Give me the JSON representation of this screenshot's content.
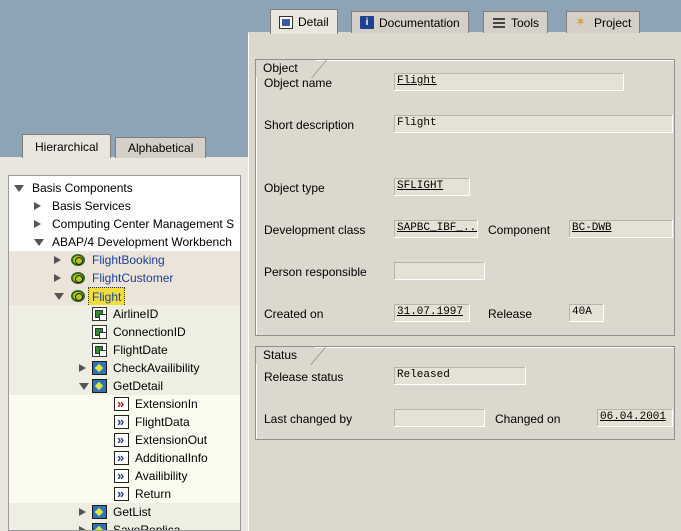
{
  "colors": {
    "background_blue": "#8fa3b6",
    "panel": "#dcd8ce",
    "link_blue": "#1a3f9a",
    "selection": "#f1dd3a"
  },
  "right_tabs": [
    {
      "label": "Detail",
      "icon": "detail-icon",
      "active": true
    },
    {
      "label": "Documentation",
      "icon": "info-icon",
      "active": false
    },
    {
      "label": "Tools",
      "icon": "tools-icon",
      "active": false
    },
    {
      "label": "Project",
      "icon": "wand-icon",
      "active": false
    }
  ],
  "object_group": {
    "title": "Object",
    "object_name": {
      "label": "Object name",
      "value": "Flight"
    },
    "short_description": {
      "label": "Short description",
      "value": "Flight"
    },
    "object_type": {
      "label": "Object type",
      "value": "SFLIGHT"
    },
    "development_class": {
      "label": "Development class",
      "value": "SAPBC_IBF_..."
    },
    "component": {
      "label": "Component",
      "value": "BC-DWB"
    },
    "person_responsible": {
      "label": "Person responsible",
      "value": ""
    },
    "created_on": {
      "label": "Created on",
      "value": "31.07.1997"
    },
    "release": {
      "label": "Release",
      "value": "40A"
    }
  },
  "status_group": {
    "title": "Status",
    "release_status": {
      "label": "Release status",
      "value": "Released"
    },
    "last_changed_by": {
      "label": "Last changed by",
      "value": ""
    },
    "changed_on": {
      "label": "Changed on",
      "value": "06.04.2001"
    }
  },
  "left_tabs": [
    {
      "label": "Hierarchical",
      "active": true
    },
    {
      "label": "Alphabetical",
      "active": false
    }
  ],
  "tree": [
    {
      "label": "Basis Components",
      "level": 0,
      "state": "expanded",
      "icon": ""
    },
    {
      "label": "Basis Services",
      "level": 1,
      "state": "collapsed",
      "icon": ""
    },
    {
      "label": "Computing Center Management S",
      "level": 1,
      "state": "collapsed",
      "icon": ""
    },
    {
      "label": "ABAP/4 Development Workbench",
      "level": 1,
      "state": "expanded",
      "icon": ""
    },
    {
      "label": "FlightBooking",
      "level": 2,
      "state": "collapsed",
      "icon": "object-icon"
    },
    {
      "label": "FlightCustomer",
      "level": 2,
      "state": "collapsed",
      "icon": "object-icon"
    },
    {
      "label": "Flight",
      "level": 2,
      "state": "expanded",
      "icon": "object-icon",
      "selected": true
    },
    {
      "label": "AirlineID",
      "level": 3,
      "state": "leaf",
      "icon": "attribute-icon"
    },
    {
      "label": "ConnectionID",
      "level": 3,
      "state": "leaf",
      "icon": "attribute-icon"
    },
    {
      "label": "FlightDate",
      "level": 3,
      "state": "leaf",
      "icon": "attribute-icon"
    },
    {
      "label": "CheckAvailibility",
      "level": 3,
      "state": "collapsed",
      "icon": "method-icon"
    },
    {
      "label": "GetDetail",
      "level": 3,
      "state": "expanded",
      "icon": "method-icon"
    },
    {
      "label": "ExtensionIn",
      "level": 4,
      "state": "leaf",
      "icon": "import-parameter-icon"
    },
    {
      "label": "FlightData",
      "level": 4,
      "state": "leaf",
      "icon": "export-parameter-icon"
    },
    {
      "label": "ExtensionOut",
      "level": 4,
      "state": "leaf",
      "icon": "export-parameter-icon"
    },
    {
      "label": "AdditionalInfo",
      "level": 4,
      "state": "leaf",
      "icon": "export-parameter-icon"
    },
    {
      "label": "Availibility",
      "level": 4,
      "state": "leaf",
      "icon": "export-parameter-icon"
    },
    {
      "label": "Return",
      "level": 4,
      "state": "leaf",
      "icon": "export-parameter-icon"
    },
    {
      "label": "GetList",
      "level": 3,
      "state": "collapsed",
      "icon": "method-icon"
    },
    {
      "label": "SaveReplica",
      "level": 3,
      "state": "collapsed",
      "icon": "method-icon"
    }
  ]
}
